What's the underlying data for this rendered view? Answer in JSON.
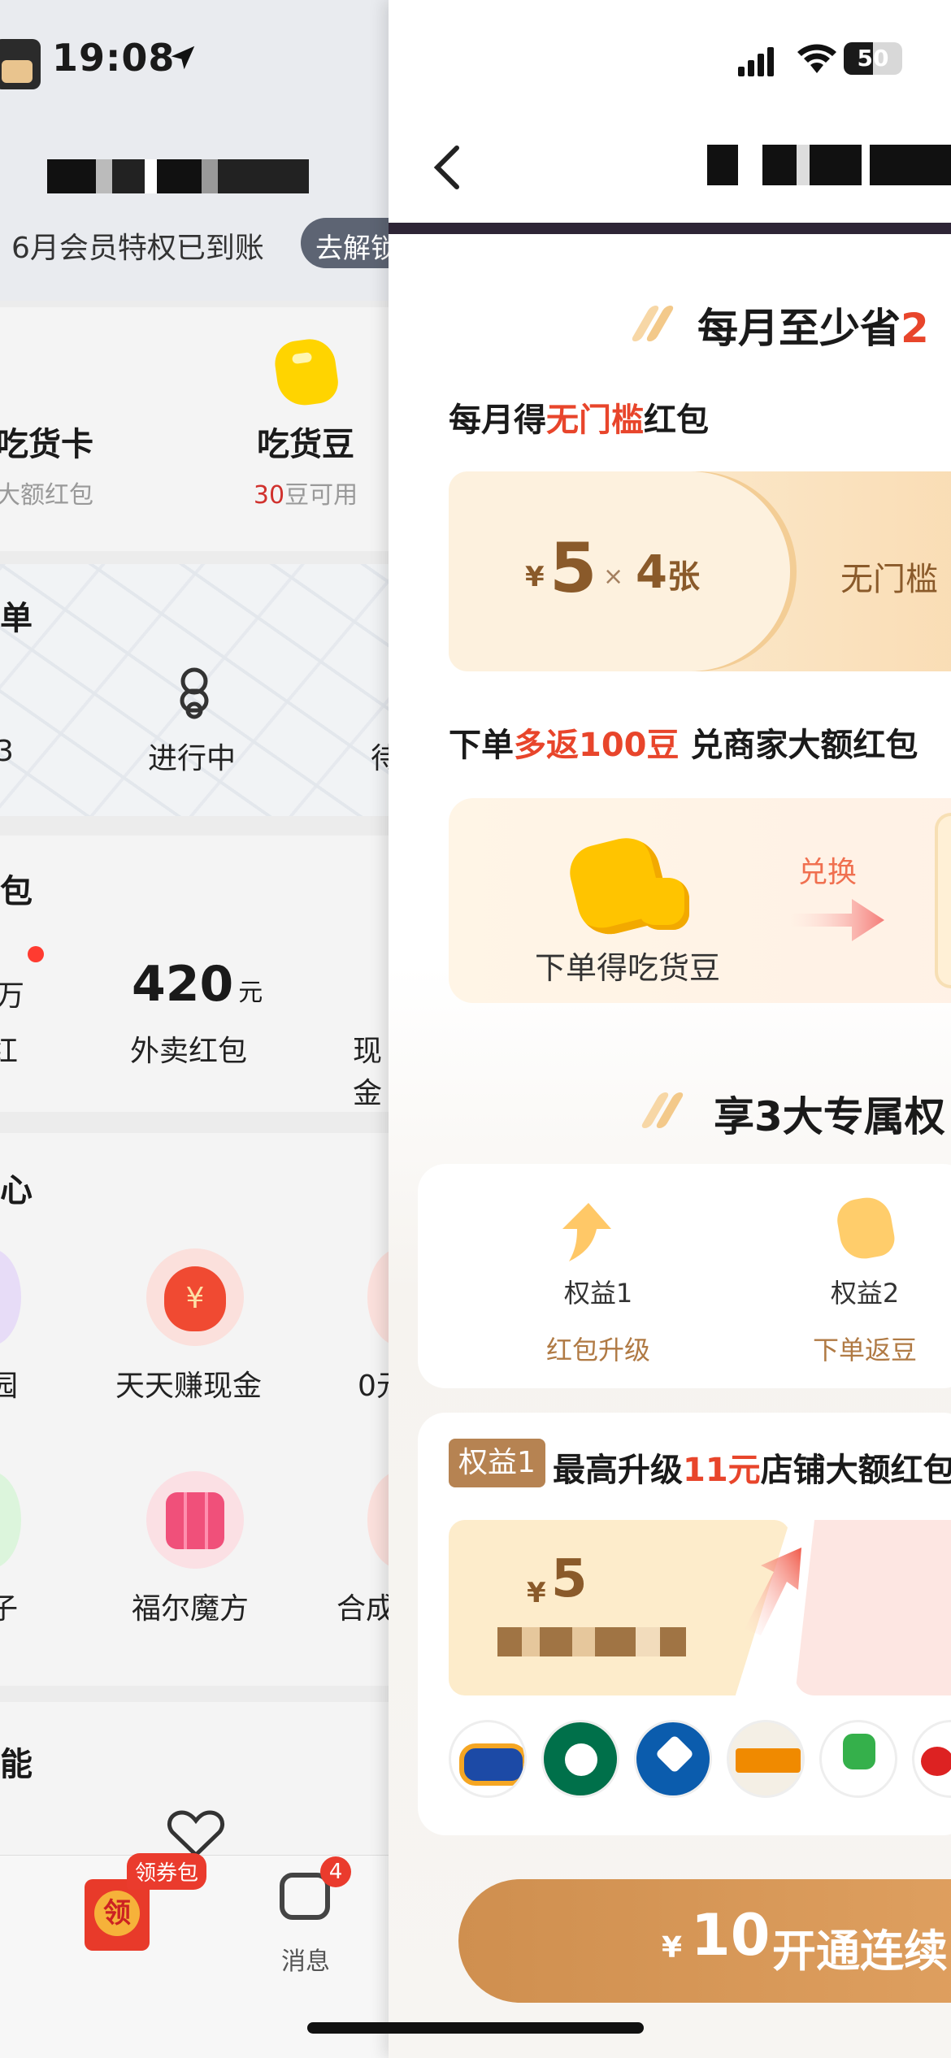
{
  "status_bar": {
    "time": "19:08",
    "battery": "50",
    "battery_level": 0.5
  },
  "left": {
    "member_line": "6月会员特权已到账",
    "unlock_button": "去解锁",
    "assets": [
      {
        "title": "吃货卡",
        "sub": "大额红包"
      },
      {
        "title": "吃货豆",
        "sub_num": "30",
        "sub_suffix": "豆可用"
      }
    ],
    "orders": {
      "title": "单",
      "status_partial_left": "3",
      "status_main": "进行中",
      "status_partial_right": "待"
    },
    "wallet": {
      "title": "包",
      "item_left_partial": "万",
      "item_left_partial2": "红",
      "amount": "420",
      "unit": "元",
      "amount_label": "外卖红包",
      "item_right_partial": "现金"
    },
    "center": {
      "title": "心",
      "items_row1": [
        {
          "label_partial": "园"
        },
        {
          "label": "天天赚现金"
        },
        {
          "label_partial": "0元"
        }
      ],
      "items_row2": [
        {
          "label_partial": "子"
        },
        {
          "label": "福尔魔方"
        },
        {
          "label_partial": "合成"
        }
      ]
    },
    "tools": {
      "title": "能"
    },
    "tabbar": {
      "coupon_badge": "领券包",
      "message_label": "消息",
      "message_count": "4"
    }
  },
  "right": {
    "section1": {
      "title_prefix": "每月至少省",
      "title_hl": "2"
    },
    "monthly": {
      "prefix": "每月得",
      "hl": "无门槛",
      "suffix": "红包"
    },
    "coupon": {
      "currency": "¥",
      "value": "5",
      "times": "×",
      "count": "4",
      "count_unit": "张",
      "tag": "无门槛"
    },
    "beans": {
      "prefix": "下单",
      "hl": "多返100豆",
      "suffix": " 兑商家大额红包",
      "bean_label": "下单得吃货豆",
      "exchange_label": "兑换"
    },
    "section2": {
      "title": "享3大专属权"
    },
    "perks": [
      {
        "name": "权益1",
        "desc": "红包升级"
      },
      {
        "name": "权益2",
        "desc": "下单返豆"
      }
    ],
    "perk_detail": {
      "badge": "权益1",
      "title_prefix": "最高升级",
      "title_hl": "11元",
      "title_suffix": "店铺大额红包"
    },
    "shop_coupon": {
      "currency": "¥",
      "value": "5"
    },
    "brands": [
      "burger-king",
      "starbucks",
      "dominos",
      "yoshinoya",
      "dicos",
      "dairy-queen"
    ],
    "cta": {
      "currency": "¥",
      "amount": "10",
      "label": "开通连续"
    }
  }
}
